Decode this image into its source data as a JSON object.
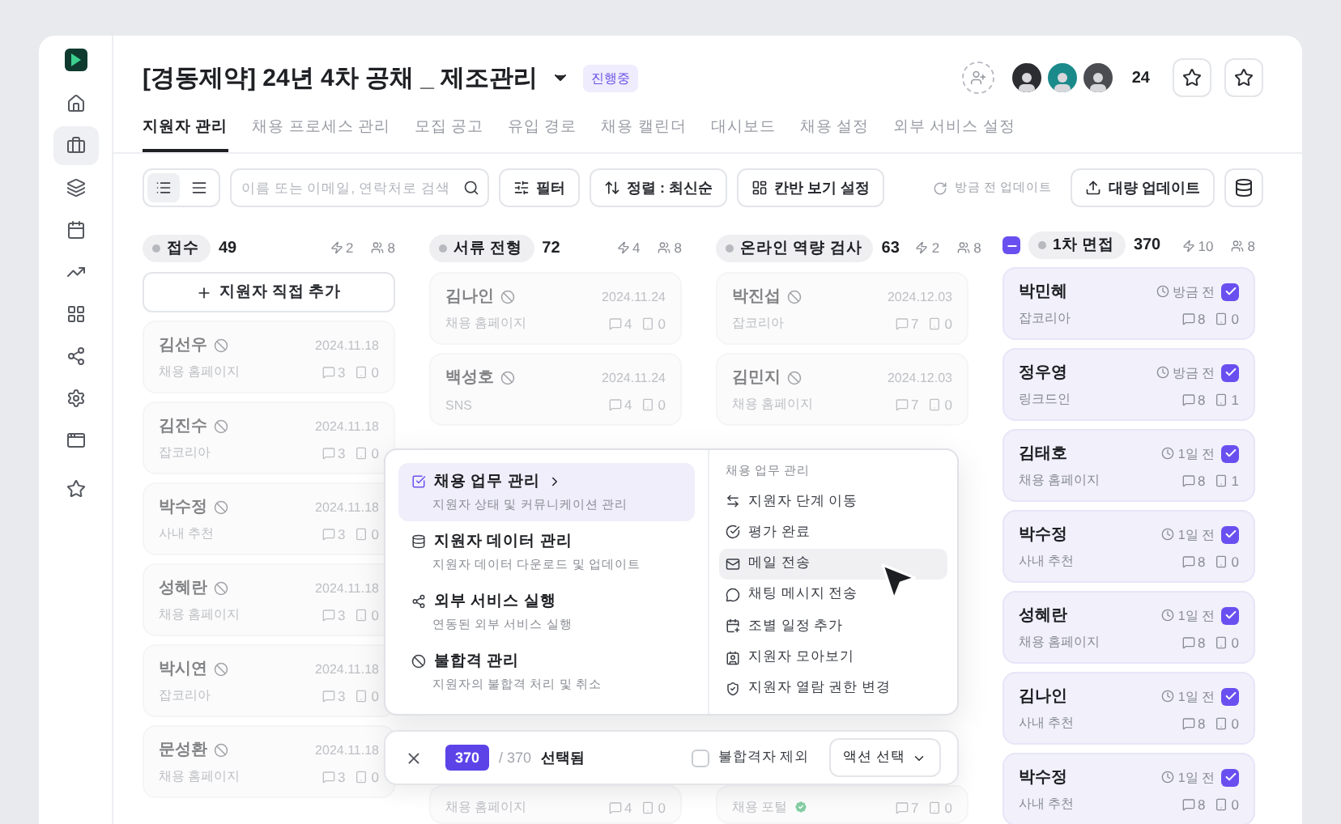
{
  "sidebar": {
    "items": [
      {
        "selected": false
      },
      {
        "selected": true
      },
      {
        "selected": false
      },
      {
        "selected": false
      },
      {
        "selected": false
      },
      {
        "selected": false
      },
      {
        "selected": false
      },
      {
        "selected": false
      },
      {
        "selected": false
      },
      {
        "selected": false
      }
    ]
  },
  "header": {
    "title": "[경동제약] 24년 4차 공채 _ 제조관리",
    "status_badge": "진행중",
    "member_count": "24"
  },
  "tabs": [
    {
      "label": "지원자 관리",
      "selected": true
    },
    {
      "label": "채용 프로세스 관리",
      "selected": false
    },
    {
      "label": "모집 공고",
      "selected": false
    },
    {
      "label": "유입 경로",
      "selected": false
    },
    {
      "label": "채용 캘린더",
      "selected": false
    },
    {
      "label": "대시보드",
      "selected": false
    },
    {
      "label": "채용 설정",
      "selected": false
    },
    {
      "label": "외부 서비스 설정",
      "selected": false
    }
  ],
  "toolbar": {
    "view_toggle": [
      {
        "selected": true
      },
      {
        "selected": false
      }
    ],
    "search": {
      "placeholder": "이름 또는 이메일, 연락처로 검색"
    },
    "filter": "필터",
    "sort": "정렬 : 최신순",
    "kanban_settings": "칸반 보기 설정",
    "update_status": "방금 전 업데이트",
    "bulk_update": "대량 업데이트"
  },
  "columns": [
    {
      "stage": "접수",
      "count": "49",
      "automations": "2",
      "members": "8",
      "add_button": "지원자 직접 추가",
      "cards": [
        {
          "name": "김선우",
          "date": "2024.11.18",
          "source": "채용 홈페이지",
          "comments": "3",
          "files": "0",
          "disqualified": true
        },
        {
          "name": "김진수",
          "date": "2024.11.18",
          "source": "잡코리아",
          "comments": "3",
          "files": "0",
          "disqualified": true
        },
        {
          "name": "박수정",
          "date": "2024.11.18",
          "source": "사내 추천",
          "comments": "3",
          "files": "0",
          "disqualified": true
        },
        {
          "name": "성혜란",
          "date": "2024.11.18",
          "source": "채용 홈페이지",
          "comments": "3",
          "files": "0",
          "disqualified": true
        },
        {
          "name": "박시연",
          "date": "2024.11.18",
          "source": "잡코리아",
          "comments": "3",
          "files": "0",
          "disqualified": true
        },
        {
          "name": "문성환",
          "date": "2024.11.18",
          "source": "채용 홈페이지",
          "comments": "3",
          "files": "0",
          "disqualified": true
        }
      ]
    },
    {
      "stage": "서류 전형",
      "count": "72",
      "automations": "4",
      "members": "8",
      "cards": [
        {
          "name": "김나인",
          "date": "2024.11.24",
          "source": "채용 홈페이지",
          "comments": "4",
          "files": "0",
          "disqualified": true
        },
        {
          "name": "백성호",
          "date": "2024.11.24",
          "source": "SNS",
          "comments": "4",
          "files": "0",
          "disqualified": true
        },
        {
          "kind": "partial",
          "source": "채용 홈페이지",
          "comments": "4",
          "files": "0",
          "disqualified": true
        }
      ]
    },
    {
      "stage": "온라인 역량 검사",
      "count": "63",
      "automations": "2",
      "members": "8",
      "cards": [
        {
          "name": "박진섭",
          "date": "2024.12.03",
          "source": "잡코리아",
          "comments": "7",
          "files": "0",
          "disqualified": true
        },
        {
          "name": "김민지",
          "date": "2024.12.03",
          "source": "채용 홈페이지",
          "comments": "7",
          "files": "0",
          "disqualified": true
        },
        {
          "kind": "partial",
          "source": "채용 포털",
          "verified": true,
          "comments": "7",
          "files": "0",
          "disqualified": true
        }
      ]
    },
    {
      "stage": "1차 면접",
      "count": "370",
      "automations": "10",
      "members": "8",
      "indeterminate": true,
      "cards": [
        {
          "name": "박민혜",
          "time": "방금 전",
          "source": "잡코리아",
          "comments": "8",
          "files": "0",
          "disqualified": false,
          "selected": true
        },
        {
          "name": "정우영",
          "time": "방금 전",
          "source": "링크드인",
          "comments": "8",
          "files": "1",
          "disqualified": false,
          "selected": true
        },
        {
          "name": "김태호",
          "time": "1일 전",
          "source": "채용 홈페이지",
          "comments": "8",
          "files": "1",
          "disqualified": false,
          "selected": true
        },
        {
          "name": "박수정",
          "time": "1일 전",
          "source": "사내 추천",
          "comments": "8",
          "files": "0",
          "disqualified": false,
          "selected": true
        },
        {
          "name": "성혜란",
          "time": "1일 전",
          "source": "채용 홈페이지",
          "comments": "8",
          "files": "0",
          "disqualified": false,
          "selected": true
        },
        {
          "name": "김나인",
          "time": "1일 전",
          "source": "사내 추천",
          "comments": "8",
          "files": "0",
          "disqualified": false,
          "selected": true
        },
        {
          "name": "박수정",
          "time": "1일 전",
          "source": "사내 추천",
          "comments": "8",
          "files": "0",
          "disqualified": false,
          "selected": true
        }
      ]
    }
  ],
  "menu": {
    "categories": [
      {
        "title": "채용 업무 관리",
        "desc": "지원자 상태 및 커뮤니케이션 관리",
        "selected": true
      },
      {
        "title": "지원자 데이터 관리",
        "desc": "지원자 데이터 다운로드 및 업데이트",
        "selected": false
      },
      {
        "title": "외부 서비스 실행",
        "desc": "연동된 외부 서비스 실행",
        "selected": false
      },
      {
        "title": "불합격 관리",
        "desc": "지원자의 불합격 처리 및 취소",
        "selected": false
      }
    ],
    "section_label": "채용 업무 관리",
    "actions": [
      {
        "label": "지원자 단계 이동",
        "hovered": false
      },
      {
        "label": "평가 완료",
        "hovered": false
      },
      {
        "label": "메일 전송",
        "hovered": true
      },
      {
        "label": "채팅 메시지 전송",
        "hovered": false
      },
      {
        "label": "조별 일정 추가",
        "hovered": false
      },
      {
        "label": "지원자 모아보기",
        "hovered": false
      },
      {
        "label": "지원자 열람 권한 변경",
        "hovered": false
      }
    ]
  },
  "selection_bar": {
    "selected_count": "370",
    "total": "/ 370",
    "label": "선택됨",
    "exclude": {
      "label": "불합격자 제외",
      "checked": false
    },
    "action_button": "액션 선택"
  }
}
